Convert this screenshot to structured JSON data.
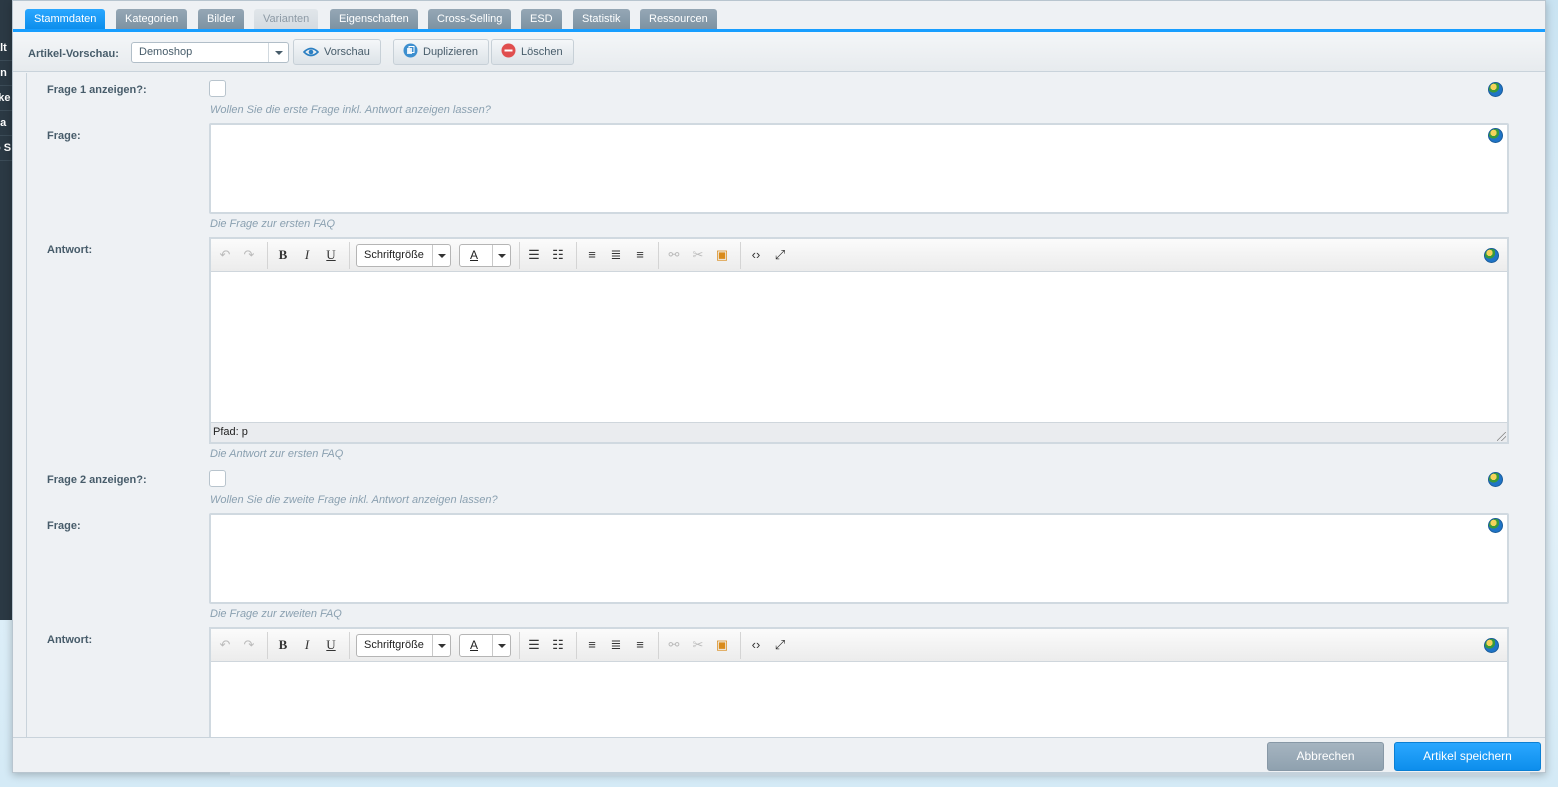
{
  "sidebar_fragments": [
    "ält",
    "en",
    "rke",
    "sa",
    "o S"
  ],
  "tabs": [
    {
      "label": "Stammdaten",
      "state": "active"
    },
    {
      "label": "Kategorien",
      "state": "normal"
    },
    {
      "label": "Bilder",
      "state": "normal"
    },
    {
      "label": "Varianten",
      "state": "disabled"
    },
    {
      "label": "Eigenschaften",
      "state": "normal"
    },
    {
      "label": "Cross-Selling",
      "state": "normal"
    },
    {
      "label": "ESD",
      "state": "normal"
    },
    {
      "label": "Statistik",
      "state": "normal"
    },
    {
      "label": "Ressourcen",
      "state": "normal"
    }
  ],
  "toolbar": {
    "preview_label": "Artikel-Vorschau:",
    "shop_value": "Demoshop",
    "preview_button": "Vorschau",
    "duplicate_button": "Duplizieren",
    "delete_button": "Löschen"
  },
  "faq1": {
    "show_label": "Frage 1 anzeigen?:",
    "show_help": "Wollen Sie die erste Frage inkl. Antwort anzeigen lassen?",
    "question_label": "Frage:",
    "question_help": "Die Frage zur ersten FAQ",
    "answer_label": "Antwort:",
    "answer_help": "Die Antwort zur ersten FAQ",
    "path_text": "Pfad: p"
  },
  "faq2": {
    "show_label": "Frage 2 anzeigen?:",
    "show_help": "Wollen Sie die zweite Frage inkl. Antwort anzeigen lassen?",
    "question_label": "Frage:",
    "question_help": "Die Frage zur zweiten FAQ",
    "answer_label": "Antwort:"
  },
  "editor": {
    "font_size_label": "Schriftgröße",
    "font_color_glyph": "A"
  },
  "footer": {
    "cancel_button": "Abbrechen",
    "save_button": "Artikel speichern"
  },
  "colors": {
    "accent": "#189eff",
    "tab_inactive": "#8699a8",
    "text": "#475c6a",
    "help_text": "#8aa0b0"
  }
}
